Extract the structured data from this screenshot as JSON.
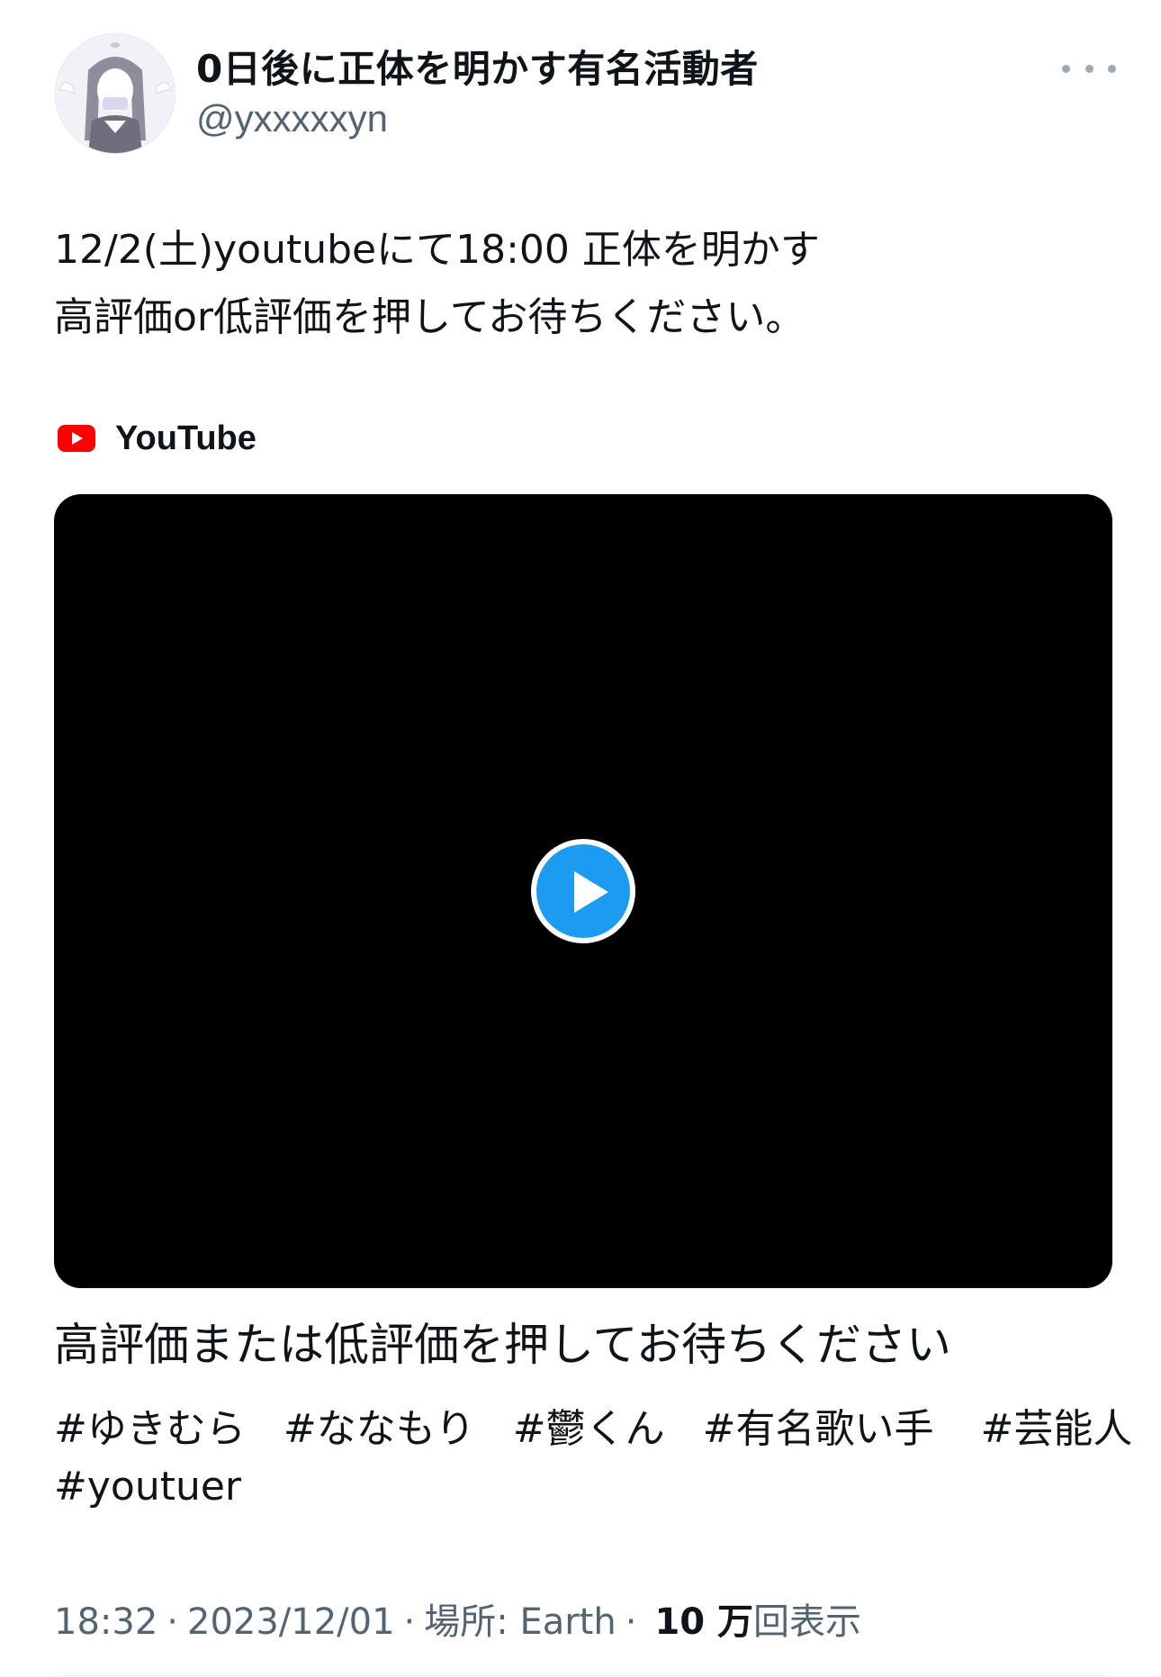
{
  "tweet": {
    "author": {
      "display_name": "0日後に正体を明かす有名活動者",
      "handle": "@yxxxxxyn",
      "avatar_icon": "anime-girl-avatar"
    },
    "more_icon": "more-horizontal-icon",
    "text_lines": [
      "12/2(土)youtubeにて18:00 正体を明かす",
      "高評価or低評価を押してお待ちください。"
    ],
    "card": {
      "source_icon": "youtube-icon",
      "source_label": "YouTube",
      "video_caption": "高評価または低評価を押してお待ちください",
      "play_icon": "play-icon"
    },
    "hashtags_row1": [
      "#ゆきむら",
      "#ななもり",
      "#鬱くん",
      "#有名歌い手",
      "#芸能人"
    ],
    "hashtags_row2": [
      "#youtuer"
    ],
    "meta": {
      "time": "18:32",
      "date": "2023/12/01",
      "location": "場所: Earth",
      "views_count": "10 万",
      "views_label": "回表示",
      "separator": "·"
    }
  },
  "colors": {
    "text": "#0f1419",
    "secondary": "#536471",
    "accent": "#1d9bf0",
    "youtube_red": "#ff0000"
  }
}
